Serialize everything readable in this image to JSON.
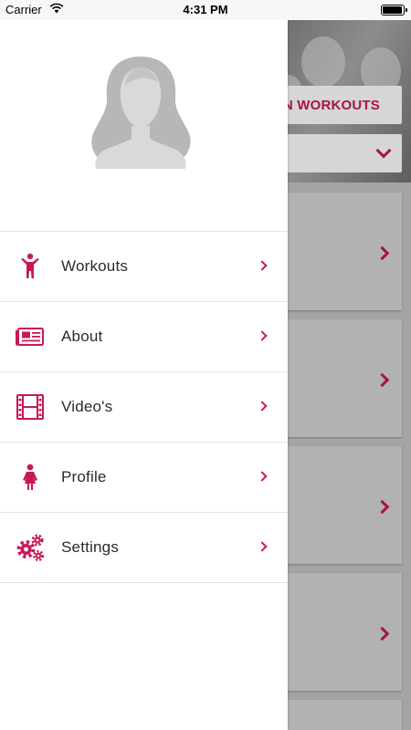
{
  "status_bar": {
    "carrier": "Carrier",
    "time": "4:31 PM",
    "battery_level": 0.95
  },
  "background": {
    "section_title": "N WORKOUTS",
    "dropdown_icon": "chevron-down-icon",
    "card_icon": "chevron-right-icon"
  },
  "drawer": {
    "avatar_icon": "female-avatar-placeholder-icon",
    "menu": [
      {
        "label": "Workouts",
        "icon": "person-workout-icon"
      },
      {
        "label": "About",
        "icon": "newspaper-icon"
      },
      {
        "label": "Video's",
        "icon": "film-icon"
      },
      {
        "label": "Profile",
        "icon": "female-person-icon"
      },
      {
        "label": "Settings",
        "icon": "gears-icon"
      }
    ]
  },
  "colors": {
    "accent": "#c8185a",
    "title_accent": "#a8124a",
    "divider": "#e4e4e4",
    "overlay_gray": "#a4a4a4"
  }
}
